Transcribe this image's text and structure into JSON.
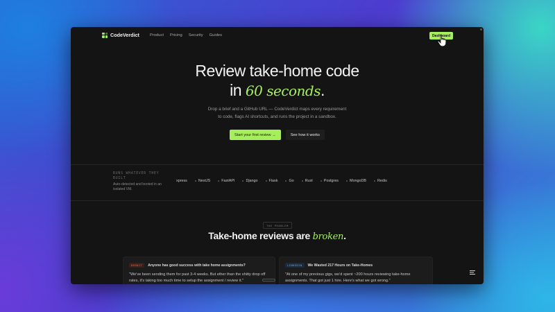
{
  "nav": {
    "brand": "CodeVerdict",
    "links": [
      "Product",
      "Pricing",
      "Security",
      "Guides"
    ],
    "dashboard_label": "Dashboard"
  },
  "hero": {
    "title_line1": "Review take-home code",
    "title_line2_prefix": "in",
    "title_line2_accent": "60 seconds",
    "title_line2_suffix": ".",
    "subtitle_line1": "Drop a brief and a GitHub URL — CodeVerdict maps every requirement",
    "subtitle_line2": "to code, flags AI shortcuts, and runs the project in a sandbox.",
    "primary_cta": "Start your first review →",
    "secondary_cta": "See how it works"
  },
  "stack": {
    "label_line1": "RUNS WHATEVER THEY",
    "label_line2": "BUILT",
    "desc_line1": "Auto-detected and booted in an",
    "desc_line2": "isolated VM.",
    "items": [
      "xpress",
      "NestJS",
      "FastAPI",
      "Django",
      "Flask",
      "Go",
      "Rust",
      "Postgres",
      "MongoDB",
      "Redis"
    ]
  },
  "problem": {
    "tag": "THE PROBLEM",
    "title_prefix": "Take-home reviews are",
    "title_accent": "broken",
    "title_suffix": "."
  },
  "cards": [
    {
      "badge": "REDDIT",
      "title": "Anyone has good success with take home assignments?",
      "body_line1": "\"We've been sending them for past 3-4 weeks. But ether than the shitty drop off",
      "body_line2": "rates, it's taking too much time to setup the assignment / review it.\""
    },
    {
      "badge": "LINKEDIN",
      "title": "We Wasted 217 Hours on Take-Homes",
      "body_line1": "\"At one of my previous gigs, we'd spent ~200 hours reviewing take-home",
      "body_line2": "assignments. That got just 1 hire. Here's what we got wrong.\""
    }
  ],
  "colors": {
    "accent": "#a6ee5c",
    "background": "#141414"
  }
}
